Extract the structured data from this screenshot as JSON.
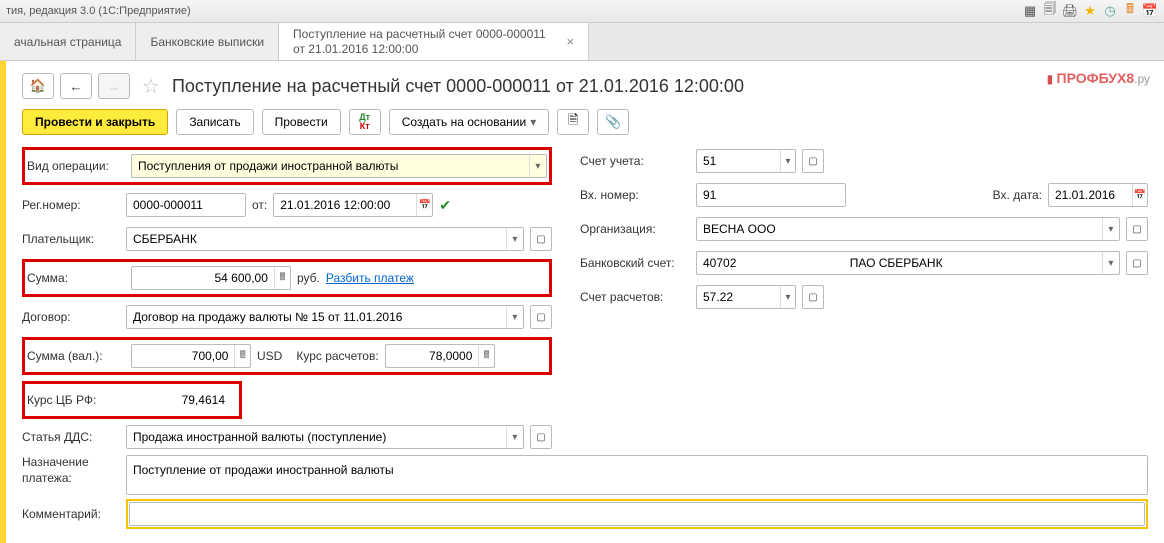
{
  "titlebar": {
    "text": "тия, редакция 3.0  (1С:Предприятие)"
  },
  "tabs": {
    "t1": "ачальная страница",
    "t2": "Банковские выписки",
    "t3": "Поступление на расчетный счет 0000-000011 от 21.01.2016 12:00:00"
  },
  "page": {
    "title": "Поступление на расчетный счет 0000-000011 от 21.01.2016 12:00:00"
  },
  "toolbar": {
    "submit": "Провести и закрыть",
    "save": "Записать",
    "post": "Провести",
    "create_based": "Создать на основании"
  },
  "labels": {
    "op_type": "Вид операции:",
    "reg_no": "Рег.номер:",
    "from": "от:",
    "payer": "Плательщик:",
    "amount": "Сумма:",
    "rub": "руб.",
    "split": "Разбить платеж",
    "contract": "Договор:",
    "amount_cur": "Сумма (вал.):",
    "usd": "USD",
    "rate_calc": "Курс расчетов:",
    "cb_rate": "Курс ЦБ РФ:",
    "dds": "Статья ДДС:",
    "purpose": "Назначение платежа:",
    "comment": "Комментарий:",
    "account": "Счет учета:",
    "in_no": "Вх. номер:",
    "in_date": "Вх. дата:",
    "org": "Организация:",
    "bank_acc": "Банковский счет:",
    "settle_acc": "Счет расчетов:"
  },
  "values": {
    "op_type": "Поступления от продажи иностранной валюты",
    "reg_no": "0000-000011",
    "reg_date": "21.01.2016 12:00:00",
    "payer": "СБЕРБАНК",
    "amount": "54 600,00",
    "contract": "Договор на продажу валюты № 15 от 11.01.2016",
    "amount_cur": "700,00",
    "rate_calc": "78,0000",
    "cb_rate": "79,4614",
    "dds": "Продажа иностранной валюты (поступление)",
    "purpose": "Поступление от продажи иностранной валюты",
    "comment": "",
    "account": "51",
    "in_no": "91",
    "in_date": "21.01.2016",
    "org": "ВЕСНА ООО",
    "bank_acc": "40702                                  ПАО СБЕРБАНК",
    "settle_acc": "57.22"
  },
  "watermark": {
    "brand": "ПРОФБУХ8",
    "suffix": ".ру"
  }
}
